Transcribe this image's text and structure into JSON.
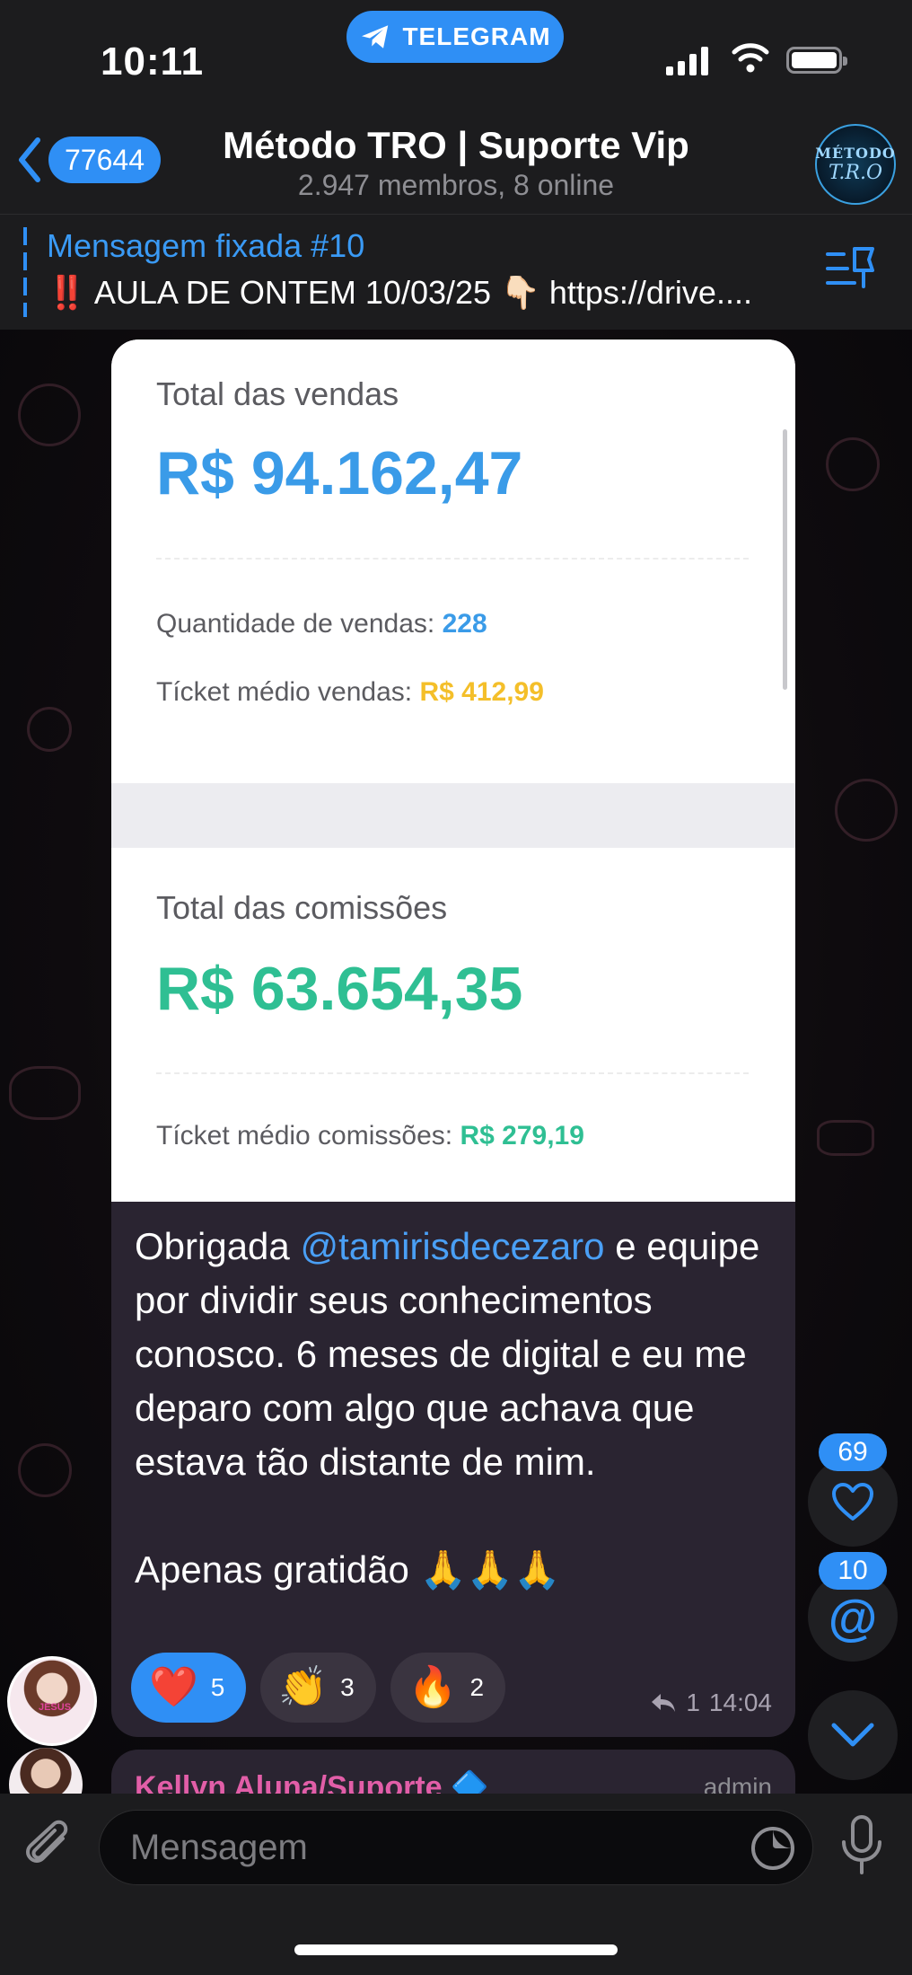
{
  "status_bar": {
    "time": "10:11",
    "telegram_pill": "TELEGRAM"
  },
  "header": {
    "back_count": "77644",
    "title": "Método TRO | Suporte Vip",
    "subtitle": "2.947 membros, 8 online",
    "avatar_line1": "MÉTODO",
    "avatar_line2": "T.R.O"
  },
  "pinned": {
    "title": "Mensagem fixada #10",
    "text": "‼️ AULA DE ONTEM 10/03/25 👇🏻 https://drive...."
  },
  "message": {
    "screenshot": {
      "sales_title": "Total das vendas",
      "sales_total": "R$ 94.162,47",
      "qty_label": "Quantidade de vendas:",
      "qty_value": "228",
      "ticket_label": "Tícket médio vendas:",
      "ticket_value": "R$ 412,99",
      "commission_title": "Total das comissões",
      "commission_total": "R$ 63.654,35",
      "commission_ticket_label": "Tícket médio comissões:",
      "commission_ticket_value": "R$ 279,19"
    },
    "text_before": "Obrigada ",
    "mention": "@tamirisdecezaro",
    "text_after": "  e equipe por dividir seus conhecimentos conosco. 6 meses de digital e eu me deparo com algo que achava que estava tão distante de mim.",
    "text_closing": "Apenas gratidão 🙏🙏🙏",
    "reactions": [
      {
        "emoji": "❤️",
        "count": "5"
      },
      {
        "emoji": "👏",
        "count": "3"
      },
      {
        "emoji": "🔥",
        "count": "2"
      }
    ],
    "reply_count": "1",
    "time": "14:04",
    "avatar_tag": "JESUS"
  },
  "next_message": {
    "sender": "Kellyn Aluna/Suporte 🔷",
    "role": "admin"
  },
  "side_buttons": {
    "reactions_badge": "69",
    "mentions_badge": "10"
  },
  "input": {
    "placeholder": "Mensagem"
  },
  "colors": {
    "accent": "#2f8ff5",
    "sales_blue": "#3a9be8",
    "ticket_yellow": "#f4bf2a",
    "commission_green": "#2fbf93"
  }
}
